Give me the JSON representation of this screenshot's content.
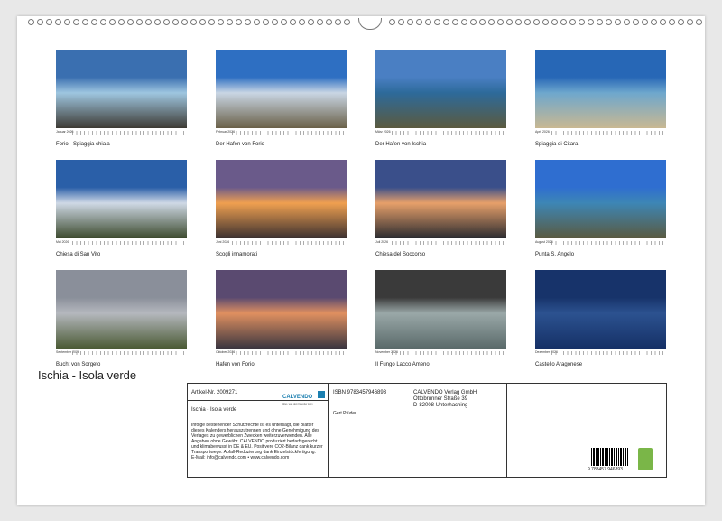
{
  "photos": [
    {
      "month": "Januar 2026",
      "caption": "Forio - Spiaggia chiaia",
      "sky": "#3a6fb0",
      "mid": "#9ec6e0",
      "ground": "#3d3a34"
    },
    {
      "month": "Februar 2026",
      "caption": "Der Hafen von Forio",
      "sky": "#2e6fc2",
      "mid": "#c9d6e4",
      "ground": "#6a6048"
    },
    {
      "month": "März 2026",
      "caption": "Der Hafen von Ischia",
      "sky": "#4a7fc3",
      "mid": "#2d6a9a",
      "ground": "#5b5a3e"
    },
    {
      "month": "April 2026",
      "caption": "Spiaggia di Citara",
      "sky": "#2767b6",
      "mid": "#6ea7cd",
      "ground": "#c9b892"
    },
    {
      "month": "Mai 2026",
      "caption": "Chiesa di San Vito",
      "sky": "#2a5fa8",
      "mid": "#cfd9e6",
      "ground": "#3c4a2e"
    },
    {
      "month": "Juni 2026",
      "caption": "Scogli innamorati",
      "sky": "#6a5a8a",
      "mid": "#f0a050",
      "ground": "#3b3030"
    },
    {
      "month": "Juli 2026",
      "caption": "Chiesa del Soccorso",
      "sky": "#3a4f8a",
      "mid": "#e7a06a",
      "ground": "#2b2b30"
    },
    {
      "month": "August 2026",
      "caption": "Punta S. Angelo",
      "sky": "#2f6ed0",
      "mid": "#3d86b5",
      "ground": "#5a5a40"
    },
    {
      "month": "September 2026",
      "caption": "Bucht von Sorgeto",
      "sky": "#8a8f9a",
      "mid": "#b5b8be",
      "ground": "#4a5a34"
    },
    {
      "month": "Oktober 2026",
      "caption": "Hafen von Forio",
      "sky": "#5a4a70",
      "mid": "#e09060",
      "ground": "#3a3540"
    },
    {
      "month": "November 2026",
      "caption": "Il Fungo Lacco Ameno",
      "sky": "#3a3a3a",
      "mid": "#9aa8a8",
      "ground": "#5a6a6a"
    },
    {
      "month": "Dezember 2026",
      "caption": "Castello Aragonese",
      "sky": "#17336a",
      "mid": "#2c5290",
      "ground": "#153066"
    }
  ],
  "cover_title": "Ischia - Isola verde",
  "info": {
    "article": "Artikel-Nr. 2009271",
    "brand": "CALVENDO",
    "brand_sub": "Alles, was dein Kalender kann",
    "subtitle": "Ischia - Isola verde",
    "legal": "Infolge bestehender Schutzrechte ist es untersagt, die Blätter dieses Kalenders herauszutrennen und ohne Genehmigung des Verlages zu gewerblichen Zwecken weiterzuverwenden. Alle Angaben ohne Gewähr. CALVENDO produziert bedarfsgerecht und klimabewusst in DE & EU. Positivere CO2-Bilanz dank kurzer Transportwege. Abfall-Reduzierung dank Einzelstückfertigung.",
    "email": "E-Mail: info@calvendo.com • www.calvendo.com",
    "isbn": "ISBN 9783457946893",
    "author": "Gert Pfüder",
    "publisher": "CALVENDO Verlag GmbH",
    "street": "Ottobrunner Straße 39",
    "city": "D-82008 Unterhaching",
    "barcode_digits": "9 783457 946893"
  },
  "colors": {
    "brand": "#1b7fb0",
    "eco": "#7ab648"
  }
}
